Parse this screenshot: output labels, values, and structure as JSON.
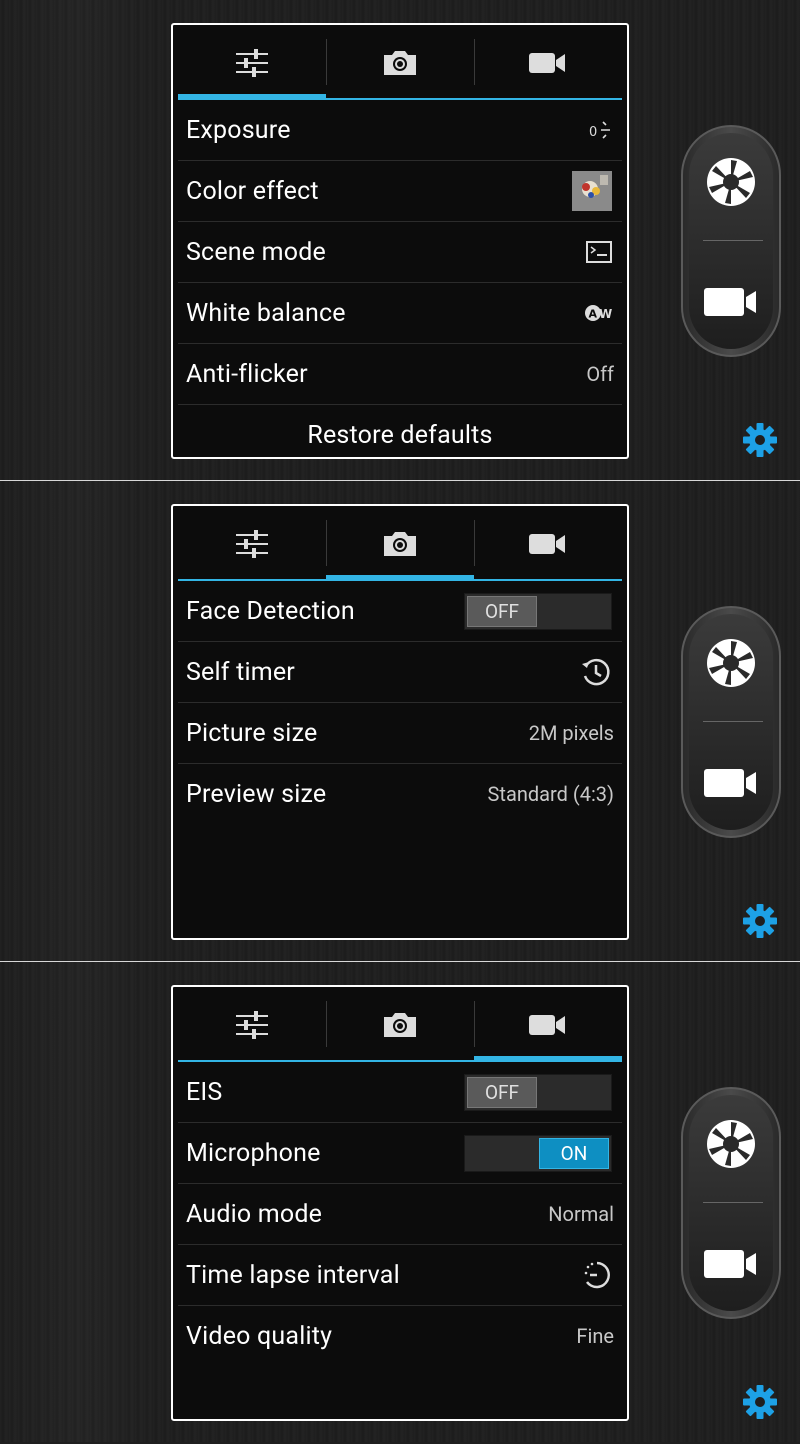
{
  "accent_color": "#33b5e5",
  "screens": [
    {
      "selected_tab": 0,
      "tabs": [
        {
          "icon": "sliders-icon"
        },
        {
          "icon": "camera-icon"
        },
        {
          "icon": "video-camera-icon"
        }
      ],
      "rows": [
        {
          "label": "Exposure",
          "icon": "exposure-icon"
        },
        {
          "label": "Color effect",
          "icon": "color-effect-thumbnail-icon"
        },
        {
          "label": "Scene mode",
          "icon": "scene-mode-icon"
        },
        {
          "label": "White balance",
          "icon": "auto-white-balance-icon"
        },
        {
          "label": "Anti-flicker",
          "value": "Off"
        },
        {
          "label": "Restore defaults"
        }
      ]
    },
    {
      "selected_tab": 1,
      "rows": [
        {
          "label": "Face Detection",
          "toggle": "OFF"
        },
        {
          "label": "Self timer",
          "icon": "self-timer-icon"
        },
        {
          "label": "Picture size",
          "value": "2M pixels"
        },
        {
          "label": "Preview size",
          "value": "Standard (4:3)"
        }
      ]
    },
    {
      "selected_tab": 2,
      "rows": [
        {
          "label": "EIS",
          "toggle": "OFF"
        },
        {
          "label": "Microphone",
          "toggle": "ON"
        },
        {
          "label": "Audio mode",
          "value": "Normal"
        },
        {
          "label": "Time lapse interval",
          "icon": "time-lapse-icon"
        },
        {
          "label": "Video quality",
          "value": "Fine"
        }
      ]
    }
  ],
  "controls": {
    "shutter_icon": "shutter-icon",
    "video_icon": "video-record-icon",
    "settings_icon": "gear-icon"
  }
}
